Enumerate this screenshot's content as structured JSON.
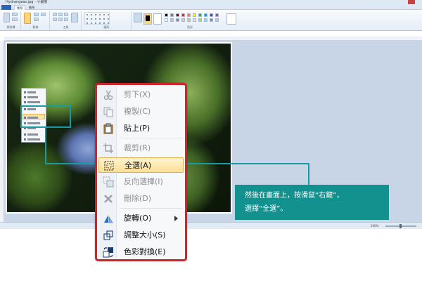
{
  "window": {
    "title": "Hydrangeas.jpg - 小畫家",
    "tabs": [
      {
        "label": "常用"
      },
      {
        "label": "檢視"
      }
    ]
  },
  "ribbon": {
    "groups": [
      {
        "label": "剪貼簿"
      },
      {
        "label": "影像"
      },
      {
        "label": "工具"
      },
      {
        "label": "圖形"
      },
      {
        "label": "色彩"
      }
    ],
    "color1_label": "色彩 1",
    "color2_label": "色彩 2",
    "edit_colors_label": "編輯色彩",
    "palette": [
      "#000000",
      "#7f7f7f",
      "#880015",
      "#ed1c24",
      "#ff7f27",
      "#fff200",
      "#22b14c",
      "#00a2e8",
      "#3f48cc",
      "#a349a4",
      "#ffffff",
      "#c3c3c3",
      "#b97a57",
      "#ffaec9",
      "#ffc90e",
      "#efe4b0",
      "#b5e61d",
      "#99d9ea",
      "#7092be",
      "#c8bfe7"
    ]
  },
  "status": {
    "position": "",
    "size": "",
    "zoom": "100%"
  },
  "context_menu": {
    "items": [
      {
        "label": "剪下(X)",
        "icon": "cut-icon",
        "enabled": false
      },
      {
        "label": "複製(C)",
        "icon": "copy-icon",
        "enabled": false
      },
      {
        "label": "貼上(P)",
        "icon": "paste-icon",
        "enabled": true
      },
      {
        "label": "裁剪(R)",
        "icon": "crop-icon",
        "enabled": false
      },
      {
        "label": "全選(A)",
        "icon": "select-all-icon",
        "enabled": true,
        "highlighted": true
      },
      {
        "label": "反向選擇(I)",
        "icon": "invert-selection-icon",
        "enabled": false
      },
      {
        "label": "刪除(D)",
        "icon": "delete-icon",
        "enabled": false
      },
      {
        "label": "旋轉(O)",
        "icon": "rotate-icon",
        "enabled": true,
        "submenu": true
      },
      {
        "label": "調整大小(S)",
        "icon": "resize-icon",
        "enabled": true
      },
      {
        "label": "色彩對換(E)",
        "icon": "invert-color-icon",
        "enabled": true
      }
    ]
  },
  "callout": {
    "text_line1": "然後在畫面上，按滑鼠“右鍵”，",
    "text_line2": "選擇“全選”。",
    "color": "#12918f"
  },
  "accent_colors": {
    "menu_frame": "#d0222b",
    "highlight": "#fbde95",
    "callout_line": "#1a9aa1"
  }
}
